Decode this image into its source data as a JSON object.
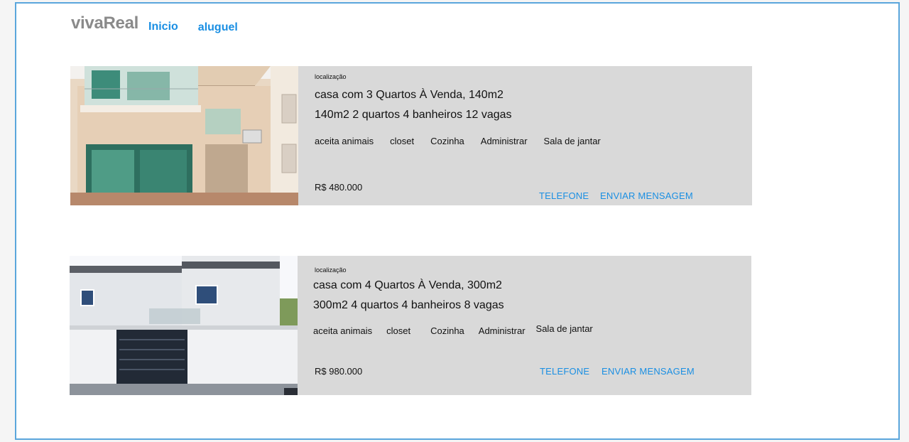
{
  "header": {
    "logo": "vivaReal",
    "nav": [
      "Inicio",
      "aluguel"
    ]
  },
  "listings": [
    {
      "location": "localização",
      "title": "casa com 3 Quartos À Venda,  140m2",
      "specs": "140m2  2 quartos  4 banheiros 12 vagas",
      "amenities": [
        "aceita animais",
        "closet",
        "Cozinha",
        "Administrar",
        "Sala de jantar"
      ],
      "price": "R$ 480.000",
      "actions": [
        "TELEFONE",
        "ENVIAR MENSAGEM"
      ]
    },
    {
      "location": "localização",
      "title": "casa com 4 Quartos À Venda,  300m2",
      "specs": "300m2  4 quartos  4 banheiros 8 vagas",
      "amenities": [
        "aceita animais",
        "closet",
        "Cozinha",
        "Administrar",
        "Sala de jantar"
      ],
      "price": "R$ 980.000",
      "actions": [
        "TELEFONE",
        "ENVIAR MENSAGEM"
      ]
    }
  ],
  "colors": {
    "accent": "#1a8fe3",
    "frame_border": "#5aa6dc",
    "card_bg": "#d9d9d9",
    "logo": "#8a8a8a"
  }
}
